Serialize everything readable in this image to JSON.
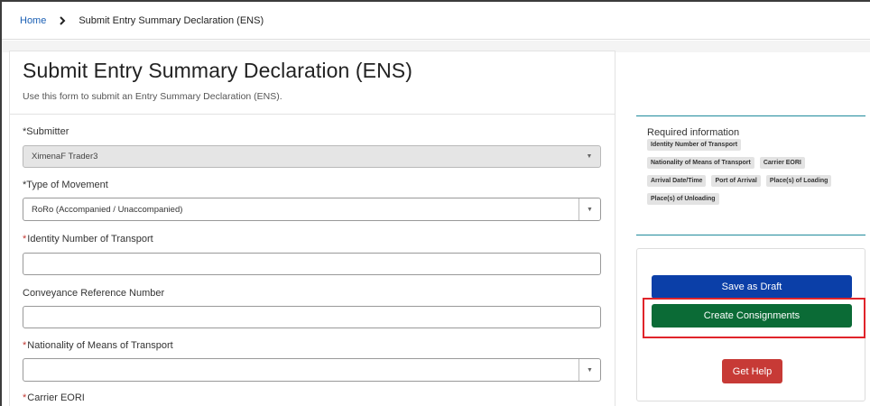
{
  "breadcrumb": {
    "home": "Home",
    "current": "Submit Entry Summary Declaration (ENS)"
  },
  "form": {
    "title": "Submit Entry Summary Declaration (ENS)",
    "subtitle": "Use this form to submit an Entry Summary Declaration (ENS).",
    "required_marker": "*",
    "fields": {
      "submitter": {
        "label": "Submitter",
        "value": "XimenaF Trader3"
      },
      "type_of_movement": {
        "label": "Type of Movement",
        "value": "RoRo (Accompanied / Unaccompanied)"
      },
      "identity_number": {
        "label": "Identity Number of Transport",
        "value": ""
      },
      "conveyance_reference": {
        "label": "Conveyance Reference Number",
        "value": ""
      },
      "nationality": {
        "label": "Nationality of Means of Transport",
        "value": ""
      },
      "carrier_eori": {
        "label": "Carrier EORI"
      }
    }
  },
  "required_info": {
    "title": "Required information",
    "tags": [
      "Identity Number of Transport",
      "Nationality of Means of Transport",
      "Carrier EORI",
      "Arrival Date/Time",
      "Port of Arrival",
      "Place(s) of Loading",
      "Place(s) of Unloading"
    ]
  },
  "actions": {
    "save_draft": "Save as Draft",
    "create_consignments": "Create Consignments",
    "get_help": "Get Help"
  },
  "colors": {
    "save_draft": "#0b3fa8",
    "create_consignments": "#0b6b36",
    "get_help": "#c73a36",
    "highlight": "#e0242a"
  }
}
